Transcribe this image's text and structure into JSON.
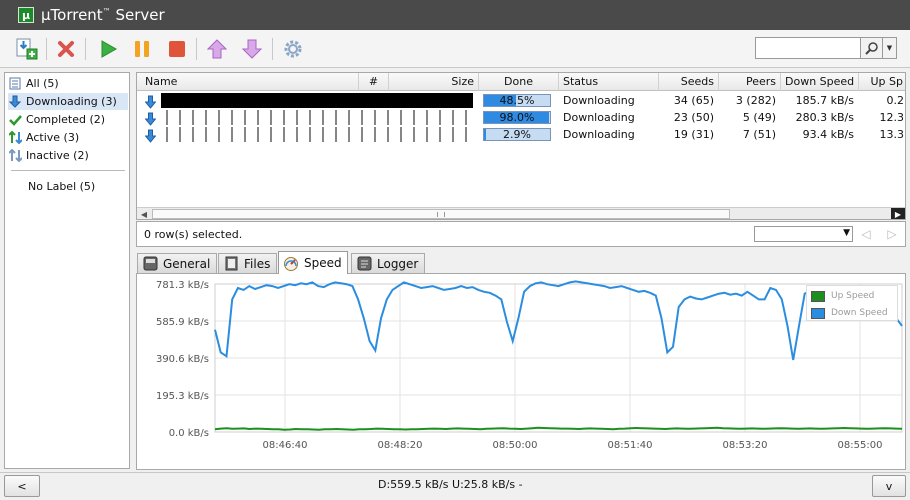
{
  "titlebar": {
    "app_name": "µTorrent",
    "trademark": "™",
    "edition": " Server"
  },
  "toolbar": {
    "buttons": [
      {
        "name": "add-torrent",
        "color": "#2e7bc4"
      },
      {
        "name": "remove",
        "color": "#d9534f"
      },
      {
        "name": "start",
        "color": "#3cb043"
      },
      {
        "name": "pause",
        "color": "#f2a324"
      },
      {
        "name": "stop",
        "color": "#e0553a"
      },
      {
        "name": "move-up",
        "color": "#c58ad8"
      },
      {
        "name": "move-down",
        "color": "#c58ad8"
      },
      {
        "name": "settings",
        "color": "#8aa6c8"
      }
    ],
    "search": {
      "value": "",
      "placeholder": ""
    }
  },
  "sidebar": {
    "items": [
      {
        "label": "All (5)",
        "icon": "list-icon"
      },
      {
        "label": "Downloading (3)",
        "icon": "download-icon",
        "selected": true
      },
      {
        "label": "Completed (2)",
        "icon": "checkmark-icon"
      },
      {
        "label": "Active (3)",
        "icon": "active-icon"
      },
      {
        "label": "Inactive (2)",
        "icon": "inactive-icon"
      }
    ],
    "label_item": "No Label (5)"
  },
  "table": {
    "columns": [
      "Name",
      "#",
      "Size",
      "Done",
      "Status",
      "Seeds",
      "Peers",
      "Down Speed",
      "Up Sp"
    ],
    "rows": [
      {
        "name": "",
        "done": "48.5%",
        "done_pct": 48.5,
        "status": "Downloading",
        "seeds": "34 (65)",
        "peers": "3 (282)",
        "down_speed": "185.7 kB/s",
        "up_speed": "0.2"
      },
      {
        "name": "",
        "done": "98.0%",
        "done_pct": 98.0,
        "status": "Downloading",
        "seeds": "23 (50)",
        "peers": "5 (49)",
        "down_speed": "280.3 kB/s",
        "up_speed": "12.3"
      },
      {
        "name": "",
        "done": "2.9%",
        "done_pct": 2.9,
        "status": "Downloading",
        "seeds": "19 (31)",
        "peers": "7 (51)",
        "down_speed": "93.4 kB/s",
        "up_speed": "13.3"
      }
    ],
    "selection_text": "0 row(s) selected."
  },
  "tabs": [
    {
      "label": "General",
      "icon": "info-icon"
    },
    {
      "label": "Files",
      "icon": "files-icon"
    },
    {
      "label": "Speed",
      "icon": "speed-icon",
      "active": true
    },
    {
      "label": "Logger",
      "icon": "logger-icon"
    }
  ],
  "speed_graph": {
    "y_ticks": [
      "781.3 kB/s",
      "585.9 kB/s",
      "390.6 kB/s",
      "195.3 kB/s",
      "0.0 kB/s"
    ],
    "x_ticks": [
      "08:46:40",
      "08:48:20",
      "08:50:00",
      "08:51:40",
      "08:53:20",
      "08:55:00"
    ],
    "series": [
      {
        "name": "Up Speed",
        "color": "#1e8f1e"
      },
      {
        "name": "Down Speed",
        "color": "#2b8de0"
      }
    ],
    "down_samples": [
      540,
      420,
      400,
      700,
      760,
      750,
      770,
      755,
      765,
      775,
      770,
      760,
      770,
      780,
      775,
      785,
      780,
      790,
      770,
      765,
      780,
      790,
      785,
      780,
      770,
      700,
      600,
      480,
      430,
      600,
      700,
      750,
      770,
      790,
      780,
      770,
      760,
      765,
      770,
      760,
      750,
      755,
      760,
      770,
      760,
      765,
      750,
      740,
      735,
      720,
      700,
      580,
      480,
      600,
      740,
      770,
      785,
      790,
      780,
      775,
      770,
      780,
      790,
      795,
      790,
      785,
      780,
      775,
      770,
      760,
      765,
      770,
      760,
      750,
      740,
      745,
      735,
      720,
      600,
      420,
      450,
      660,
      700,
      715,
      705,
      700,
      710,
      720,
      730,
      735,
      725,
      730,
      720,
      740,
      720,
      700,
      700,
      760,
      750,
      700,
      560,
      380,
      560,
      730,
      745,
      755,
      745,
      750,
      740,
      700,
      680,
      720,
      740,
      735,
      745,
      735,
      700,
      680,
      640,
      600,
      560
    ],
    "up_samples": [
      15,
      18,
      20,
      17,
      18,
      19,
      16,
      18,
      17,
      16,
      15,
      14,
      12,
      13,
      16,
      15,
      14,
      13,
      12,
      14,
      15,
      16,
      14,
      13,
      12,
      14,
      15,
      16,
      18,
      17,
      16,
      15,
      14,
      13,
      14,
      15,
      16,
      17,
      18,
      17,
      16,
      18,
      19,
      18,
      17,
      16,
      15,
      17,
      18,
      19,
      20,
      18,
      17,
      16,
      18,
      20,
      22,
      21,
      20,
      19,
      18,
      18,
      17,
      16,
      18,
      19,
      18,
      17,
      16,
      15,
      17,
      18,
      20,
      21,
      20,
      19,
      18,
      17,
      16,
      18,
      19,
      18,
      17,
      18,
      19,
      20,
      21,
      22,
      20,
      19,
      18,
      17,
      18,
      19,
      18,
      17,
      18,
      19,
      20,
      19,
      18,
      17,
      18,
      19,
      18,
      17,
      18,
      19,
      20,
      21,
      20,
      19,
      18,
      17,
      18,
      19,
      20,
      19,
      18,
      17
    ]
  },
  "statusbar": {
    "left_label": "<",
    "text": "D:559.5 kB/s U:25.8 kB/s -",
    "right_label": "v"
  }
}
